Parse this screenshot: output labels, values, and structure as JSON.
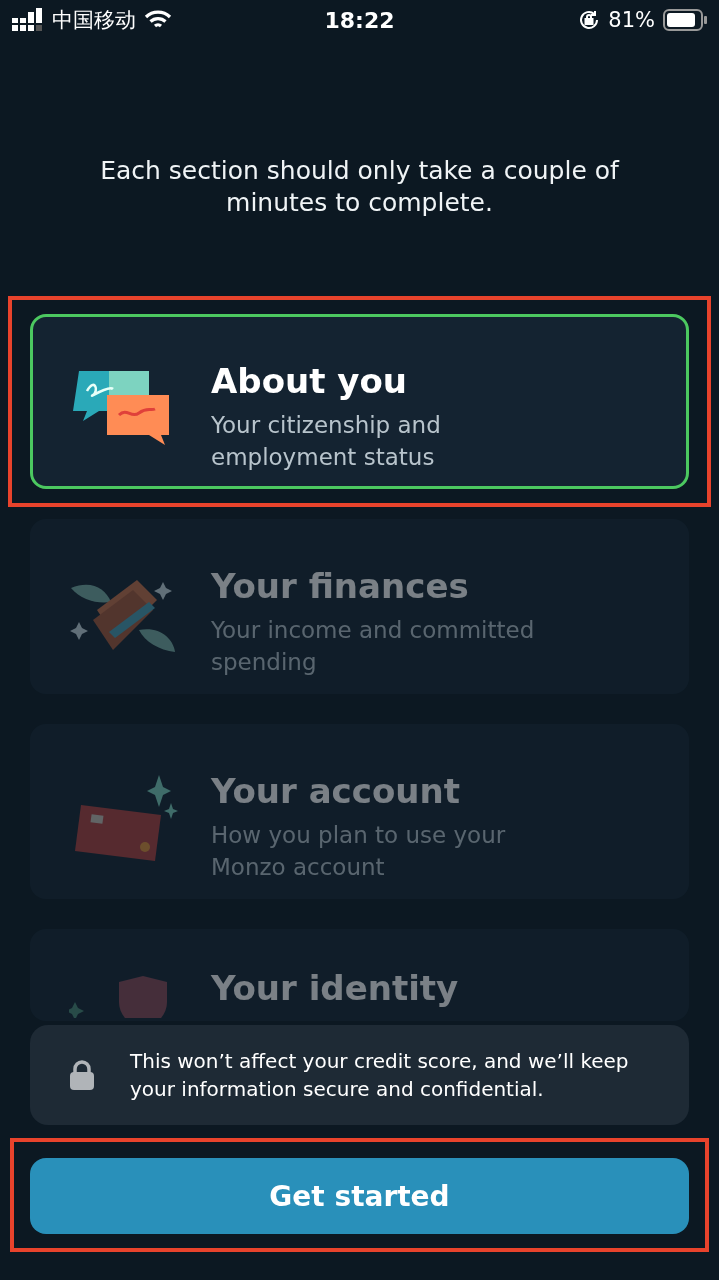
{
  "status_bar": {
    "carrier": "中国移动",
    "time": "18:22",
    "battery": "81%"
  },
  "intro": "Each section should only take a couple of minutes to complete.",
  "sections": [
    {
      "title": "About you",
      "subtitle": "Your citizenship and employment status",
      "selected": true,
      "highlighted": true,
      "kind": "chat"
    },
    {
      "title": "Your finances",
      "subtitle": "Your income and committed spending",
      "selected": false,
      "highlighted": false,
      "kind": "money"
    },
    {
      "title": "Your account",
      "subtitle": "How you plan to use your Monzo account",
      "selected": false,
      "highlighted": false,
      "kind": "card"
    },
    {
      "title": "Your identity",
      "selected": false,
      "highlighted": false,
      "kind": "identity"
    }
  ],
  "notice": "This won’t affect your credit score, and we’ll keep your information secure and confidential.",
  "button": {
    "label": "Get started",
    "highlighted": true
  }
}
